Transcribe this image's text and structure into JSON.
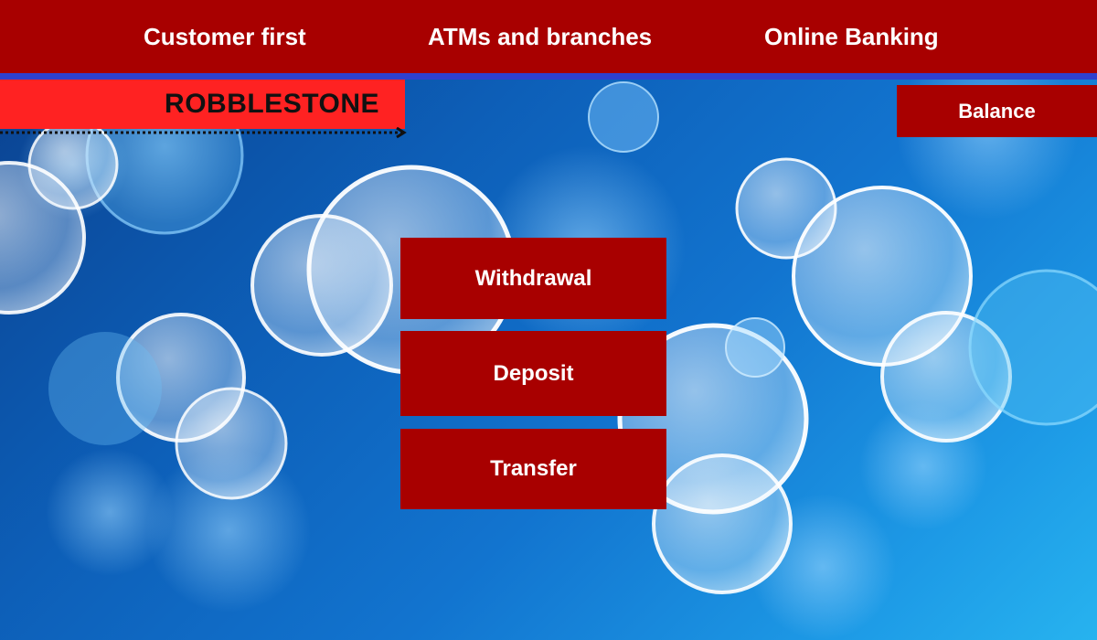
{
  "nav": {
    "customer_first": "Customer first",
    "atms_branches": "ATMs and branches",
    "online_banking": "Online Banking"
  },
  "brand": {
    "name": "ROBBLESTONE"
  },
  "balance_label": "Balance",
  "actions": {
    "withdrawal": "Withdrawal",
    "deposit": "Deposit",
    "transfer": "Transfer"
  },
  "colors": {
    "nav_background": "#a80000",
    "nav_strip": "#2f40d0",
    "brand_background": "#ff2222",
    "button_background": "#a80000",
    "button_text": "#ffffff",
    "page_background": "#1274cf"
  },
  "icons": {
    "dotted_arrow": "dotted-arrow-icon"
  }
}
